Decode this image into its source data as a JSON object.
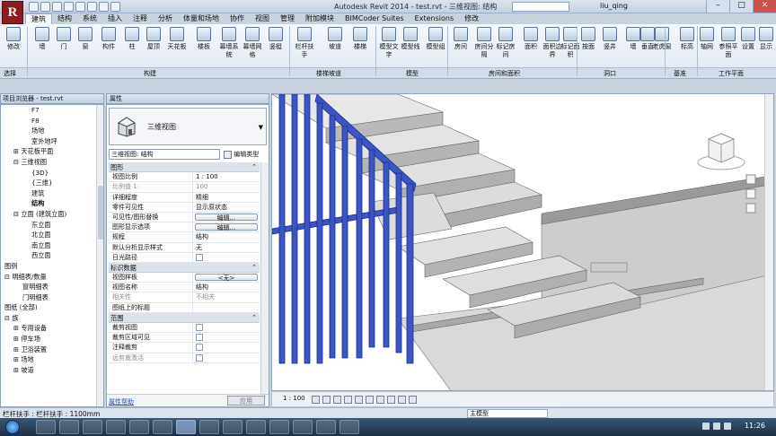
{
  "titlebar": {
    "title": "Autodesk Revit 2014 - test.rvt - 三维视图: 结构",
    "user": "liu_qing",
    "logo": "R"
  },
  "ribbon": {
    "tabs": [
      "建筑",
      "结构",
      "系统",
      "插入",
      "注释",
      "分析",
      "体量和场地",
      "协作",
      "视图",
      "管理",
      "附加模块",
      "BIMCoder Suites",
      "Extensions",
      "修改"
    ],
    "active_tab": "建筑",
    "buttons": [
      "修改",
      "墙",
      "门",
      "窗",
      "构件",
      "柱",
      "屋顶",
      "天花板",
      "楼板",
      "幕墙系统",
      "幕墙网格",
      "竖梃",
      "栏杆扶手",
      "坡道",
      "楼梯",
      "模型文字",
      "模型线",
      "模型组",
      "房间",
      "房间分隔",
      "标记房间",
      "面积",
      "面积边界",
      "标记面积",
      "按面",
      "竖井",
      "墙",
      "垂直",
      "老虎窗",
      "标高",
      "轴网",
      "参照平面",
      "设置",
      "显示",
      "查看器"
    ],
    "groups": [
      "选择",
      "构建",
      "楼梯坡道",
      "模型",
      "房间和面积",
      "洞口",
      "基准",
      "工作平面"
    ]
  },
  "project_browser": {
    "header": "项目浏览器 - test.rvt",
    "items": [
      {
        "label": "F7",
        "indent": 3,
        "toggle": ""
      },
      {
        "label": "F8",
        "indent": 3,
        "toggle": ""
      },
      {
        "label": "场地",
        "indent": 3,
        "toggle": ""
      },
      {
        "label": "室外地坪",
        "indent": 3,
        "toggle": ""
      },
      {
        "label": "天花板平面",
        "indent": 1,
        "toggle": "+"
      },
      {
        "label": "三维视图",
        "indent": 1,
        "toggle": "-"
      },
      {
        "label": "{3D}",
        "indent": 3,
        "toggle": ""
      },
      {
        "label": "{三维}",
        "indent": 3,
        "toggle": ""
      },
      {
        "label": "建筑",
        "indent": 3,
        "toggle": ""
      },
      {
        "label": "结构",
        "indent": 3,
        "toggle": "",
        "bold": true
      },
      {
        "label": "立面 (建筑立面)",
        "indent": 1,
        "toggle": "-"
      },
      {
        "label": "东立面",
        "indent": 3,
        "toggle": ""
      },
      {
        "label": "北立面",
        "indent": 3,
        "toggle": ""
      },
      {
        "label": "南立面",
        "indent": 3,
        "toggle": ""
      },
      {
        "label": "西立面",
        "indent": 3,
        "toggle": ""
      },
      {
        "label": "图例",
        "indent": 0,
        "toggle": ""
      },
      {
        "label": "明细表/数量",
        "indent": 0,
        "toggle": "-"
      },
      {
        "label": "窗明细表",
        "indent": 2,
        "toggle": ""
      },
      {
        "label": "门明细表",
        "indent": 2,
        "toggle": ""
      },
      {
        "label": "图纸 (全部)",
        "indent": 0,
        "toggle": ""
      },
      {
        "label": "族",
        "indent": 0,
        "toggle": "-"
      },
      {
        "label": "专用设备",
        "indent": 1,
        "toggle": "+"
      },
      {
        "label": "停车场",
        "indent": 1,
        "toggle": "+"
      },
      {
        "label": "卫浴装置",
        "indent": 1,
        "toggle": "+"
      },
      {
        "label": "场地",
        "indent": 1,
        "toggle": "+"
      },
      {
        "label": "坡道",
        "indent": 1,
        "toggle": "+"
      }
    ]
  },
  "properties": {
    "header": "属性",
    "type_name": "三维视图",
    "instance_select": "三维视图: 结构",
    "edit_type": "编辑类型",
    "sections": [
      {
        "name": "图形",
        "rows": [
          {
            "k": "视图比例",
            "v": "1 : 100"
          },
          {
            "k": "比例值 1:",
            "v": "100",
            "dim": true
          },
          {
            "k": "详细程度",
            "v": "精细"
          },
          {
            "k": "零件可见性",
            "v": "显示原状态"
          },
          {
            "k": "可见性/图形替换",
            "v": "编辑...",
            "btn": true
          },
          {
            "k": "图形显示选项",
            "v": "编辑...",
            "btn": true
          },
          {
            "k": "规程",
            "v": "结构"
          },
          {
            "k": "默认分析显示样式",
            "v": "无"
          },
          {
            "k": "日光路径",
            "v": "",
            "chk": true
          }
        ]
      },
      {
        "name": "标识数据",
        "rows": [
          {
            "k": "视图样板",
            "v": "<无>",
            "btn": true
          },
          {
            "k": "视图名称",
            "v": "结构"
          },
          {
            "k": "相关性",
            "v": "不相关",
            "dim": true
          },
          {
            "k": "图纸上的标题",
            "v": ""
          }
        ]
      },
      {
        "name": "范围",
        "rows": [
          {
            "k": "裁剪视图",
            "v": "",
            "chk": true
          },
          {
            "k": "裁剪区域可见",
            "v": "",
            "chk": true
          },
          {
            "k": "注释裁剪",
            "v": "",
            "chk": true
          },
          {
            "k": "远剪裁激活",
            "v": "",
            "chk": true,
            "dim": true
          }
        ]
      }
    ],
    "help_link": "属性帮助",
    "apply": "应用"
  },
  "view_control": {
    "scale": "1 : 100"
  },
  "status": {
    "text": "栏杆扶手 : 栏杆扶手 : 1100mm",
    "model": "主模型"
  },
  "taskbar": {
    "time": "11:26"
  }
}
